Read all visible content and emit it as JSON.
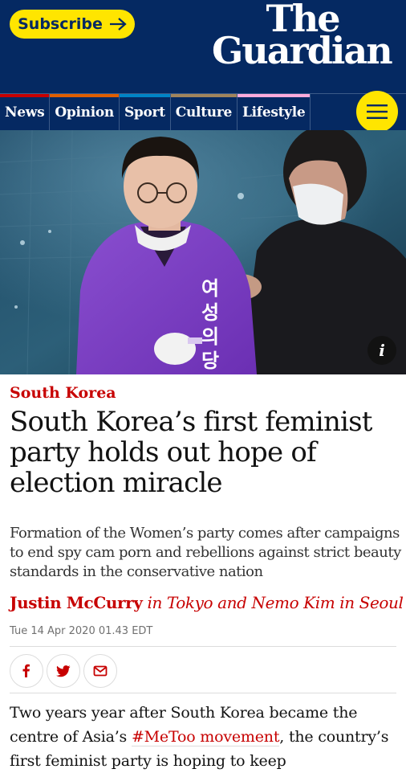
{
  "header": {
    "subscribe_label": "Subscribe",
    "logo_line1": "The",
    "logo_line2": "Guardian"
  },
  "nav": {
    "pillars": [
      {
        "label": "News",
        "color": "#c70000"
      },
      {
        "label": "Opinion",
        "color": "#e05e00"
      },
      {
        "label": "Sport",
        "color": "#0084c6"
      },
      {
        "label": "Culture",
        "color": "#a1845c"
      },
      {
        "label": "Lifestyle",
        "color": "#ffabdb"
      }
    ],
    "menu_icon": "hamburger-icon"
  },
  "hero": {
    "info_label": "i",
    "jacket_text": "여성의당"
  },
  "article": {
    "section": "South Korea",
    "headline": "South Korea’s first feminist party holds out hope of election miracle",
    "standfirst": "Formation of the Women’s party comes after campaigns to end spy cam porn and rebellions against strict beauty standards in the conservative nation",
    "author": "Justin McCurry",
    "byline_rest": " in Tokyo and Nemo Kim in Seoul",
    "date": "Tue 14 Apr 2020 01.43 EDT",
    "share_icons": [
      "facebook-icon",
      "twitter-icon",
      "email-icon"
    ],
    "body_before": "Two years year after South Korea became the centre of Asia’s ",
    "body_link": "#MeToo movement",
    "body_after": ", the country’s first feminist party is hoping to keep"
  },
  "colors": {
    "brand": "#052962",
    "accent": "#ffe500",
    "news_red": "#c70000"
  }
}
